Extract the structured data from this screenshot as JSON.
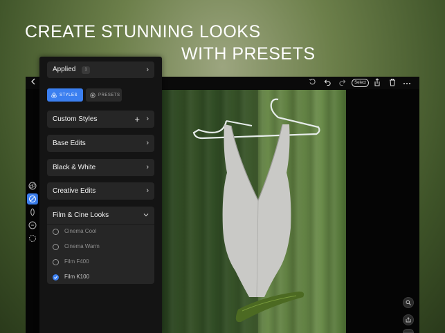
{
  "headline": {
    "line1": "CREATE STUNNING LOOKS",
    "line2": "WITH PRESETS"
  },
  "toolbar": {
    "back_icon": "chevron-left-icon",
    "select_label": "Select",
    "icons": [
      "history-icon",
      "undo-icon",
      "redo-icon",
      "share-icon",
      "trash-icon",
      "more-icon"
    ]
  },
  "panel": {
    "applied": {
      "label": "Applied",
      "count": "1"
    },
    "tabs": {
      "styles": "STYLES",
      "presets": "PRESETS"
    },
    "sections": {
      "custom_styles": "Custom Styles",
      "base_edits": "Base Edits",
      "black_white": "Black & White",
      "creative_edits": "Creative Edits",
      "film_cine": "Film & Cine Looks"
    },
    "looks": [
      {
        "label": "Cinema Cool",
        "checked": false
      },
      {
        "label": "Cinema Warm",
        "checked": false
      },
      {
        "label": "Film F400",
        "checked": false
      },
      {
        "label": "Film K100",
        "checked": true
      }
    ]
  },
  "colors": {
    "accent": "#3b7ff0",
    "panel_bg": "#141414",
    "card_bg": "#262626"
  }
}
